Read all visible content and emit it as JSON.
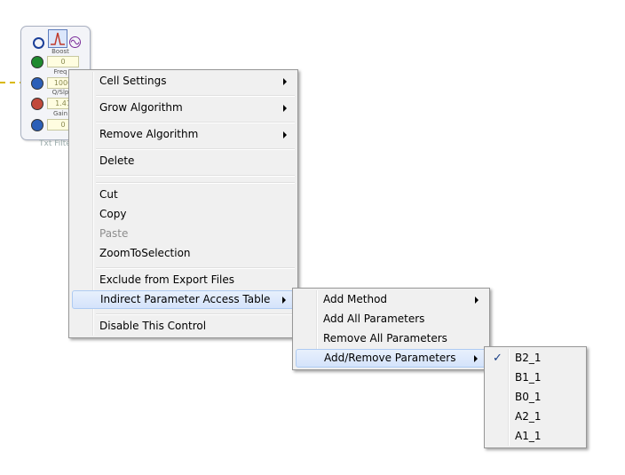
{
  "cell": {
    "boost_label": "Boost",
    "boost_value": "0",
    "freq_label": "Freq",
    "freq_value": "1000",
    "q_label": "Q/Slp",
    "q_value": "1.41",
    "gain_label": "Gain",
    "gain_value": "0",
    "caption": "Txt Filte"
  },
  "context_menu": {
    "items": [
      {
        "label": "Cell Settings",
        "submenu": true
      },
      {
        "label": "Grow Algorithm",
        "submenu": true
      },
      {
        "label": "Remove Algorithm",
        "submenu": true
      },
      {
        "label": "Delete"
      },
      {
        "label": "Cut"
      },
      {
        "label": "Copy"
      },
      {
        "label": "Paste",
        "disabled": true
      },
      {
        "label": "ZoomToSelection"
      },
      {
        "label": "Exclude from Export Files"
      },
      {
        "label": "Indirect Parameter Access Table",
        "submenu": true,
        "highlighted": true
      },
      {
        "label": "Disable This Control"
      }
    ]
  },
  "submenu1": {
    "items": [
      {
        "label": "Add Method",
        "submenu": true
      },
      {
        "label": "Add All Parameters"
      },
      {
        "label": "Remove All Parameters"
      },
      {
        "label": "Add/Remove Parameters",
        "submenu": true,
        "highlighted": true
      }
    ]
  },
  "submenu2": {
    "items": [
      {
        "label": "B2_1",
        "checked": true
      },
      {
        "label": "B1_1"
      },
      {
        "label": "B0_1"
      },
      {
        "label": "A2_1"
      },
      {
        "label": "A1_1"
      }
    ],
    "check_glyph": "✓"
  }
}
